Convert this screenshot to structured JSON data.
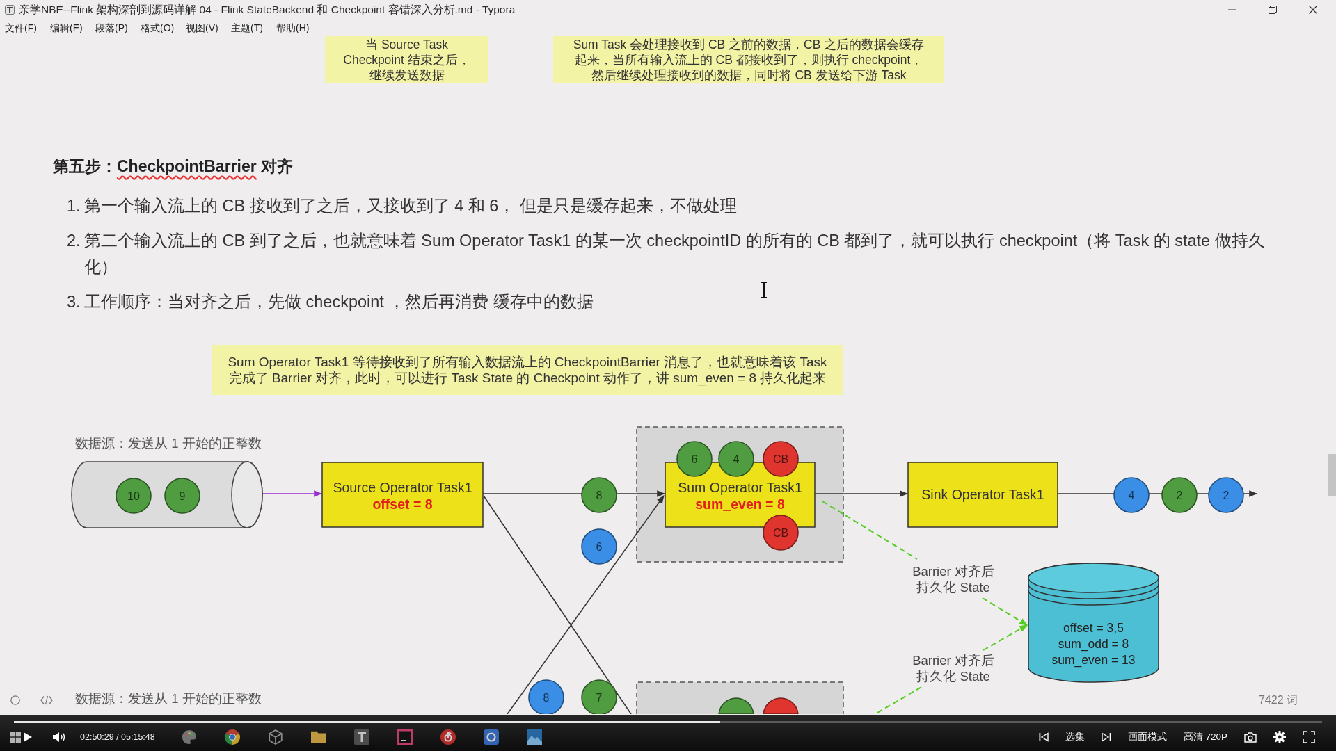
{
  "window": {
    "title": "亲学NBE--Flink 架构深剖到源码详解 04 - Flink StateBackend 和 Checkpoint 容错深入分析.md - Typora",
    "menu": [
      "文件(F)",
      "编辑(E)",
      "段落(P)",
      "格式(O)",
      "视图(V)",
      "主题(T)",
      "帮助(H)"
    ]
  },
  "document": {
    "top_notes": [
      {
        "lines": [
          "当 Source Task",
          "Checkpoint 结束之后，",
          "继续发送数据"
        ]
      },
      {
        "lines": [
          "Sum Task 会处理接收到 CB 之前的数据，CB 之后的数据会缓存",
          "起来，当所有输入流上的 CB 都接收到了，则执行 checkpoint，",
          "然后继续处理接收到的数据，同时将 CB 发送给下游 Task"
        ]
      }
    ],
    "heading": {
      "parts": [
        {
          "text": "第五步：",
          "misspelled": false
        },
        {
          "text": "CheckpointBarrier",
          "misspelled": true
        },
        {
          "text": " 对齐",
          "misspelled": false
        }
      ]
    },
    "steps": [
      {
        "number": "1.",
        "text": "第一个输入流上的 CB 接收到了之后，又接收到了 4 和 6， 但是只是缓存起来，不做处理"
      },
      {
        "number": "2.",
        "text": "第二个输入流上的 CB 到了之后，也就意味着 Sum Operator Task1 的某一次 checkpointID 的所有的 CB 都到了，就可以执行 checkpoint（将 Task 的 state 做持久化）"
      },
      {
        "number": "3.",
        "text": "工作顺序：当对齐之后，先做 checkpoint ，然后再消费 缓存中的数据"
      }
    ],
    "diagram": {
      "note": {
        "lines": [
          "Sum Operator Task1 等待接收到了所有输入数据流上的 CheckpointBarrier 消息了，也就意味着该 Task",
          "完成了 Barrier 对齐，此时，可以进行 Task State 的 Checkpoint 动作了，讲 sum_even = 8 持久化起来"
        ]
      },
      "source_labels": [
        "数据源：发送从 1 开始的正整数",
        "数据源：发送从 1 开始的正整数"
      ],
      "operators": [
        {
          "name": "Source Operator Task1",
          "state": "offset = 8"
        },
        {
          "name": "Sum Operator Task1",
          "state": "sum_even = 8"
        },
        {
          "name": "Sink Operator Task1"
        }
      ],
      "records": [
        {
          "label": "10",
          "color": "#4f9d40"
        },
        {
          "label": "9",
          "color": "#4f9d40"
        },
        {
          "label": "8",
          "color": "#4f9d40"
        },
        {
          "label": "6",
          "color": "#3a8ee6"
        },
        {
          "label": "6",
          "color": "#4f9d40"
        },
        {
          "label": "4",
          "color": "#4f9d40"
        },
        {
          "label": "CB",
          "color": "#e0342f"
        },
        {
          "label": "CB",
          "color": "#e0342f"
        },
        {
          "label": "4",
          "color": "#3a8ee6"
        },
        {
          "label": "2",
          "color": "#4f9d40"
        },
        {
          "label": "2",
          "color": "#3a8ee6"
        },
        {
          "label": "8",
          "color": "#3a8ee6"
        },
        {
          "label": "7",
          "color": "#4f9d40"
        },
        {
          "color": "#4f9d40"
        },
        {
          "color": "#e0342f"
        }
      ],
      "annotations": [
        {
          "lines": [
            "Barrier 对齐后",
            "持久化 State"
          ]
        },
        {
          "lines": [
            "Barrier 对齐后",
            "持久化 State"
          ]
        }
      ],
      "state_store": {
        "lines": [
          "offset = 3,5",
          "sum_odd = 8",
          "sum_even = 13"
        ]
      }
    },
    "status_bar": {
      "word_count": "7422 词"
    }
  },
  "player": {
    "level": 0.54,
    "time": "02:50:29 / 05:15:48",
    "buttons": [
      "选集",
      "画面模式",
      "高清 720P"
    ]
  }
}
